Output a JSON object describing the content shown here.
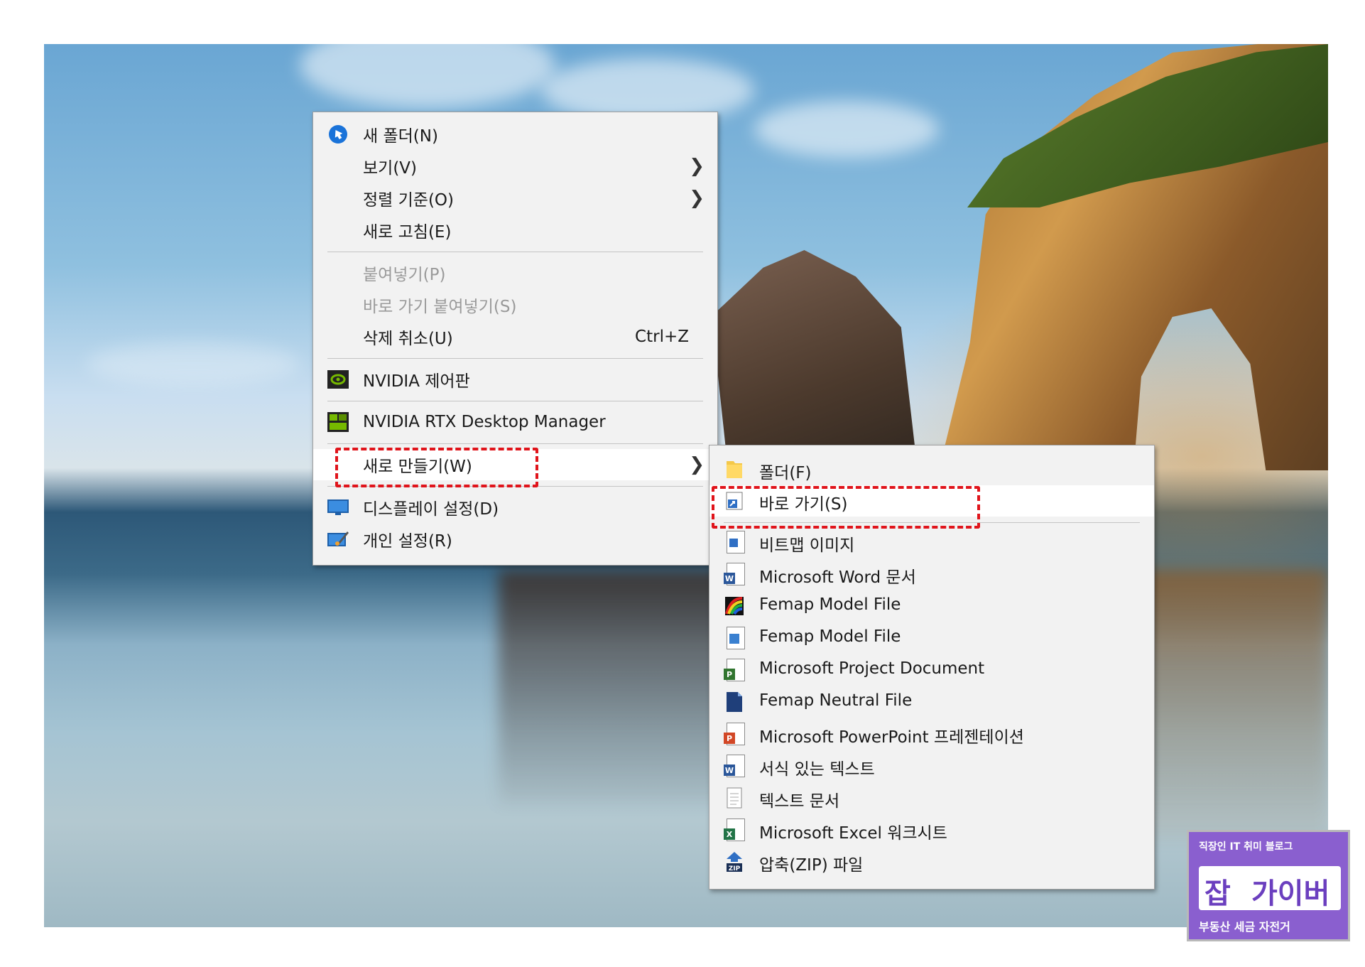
{
  "main_menu": {
    "items": [
      {
        "label": "새 폴더(N)",
        "icon": "new-folder-icon"
      },
      {
        "label": "보기(V)",
        "submenu": true
      },
      {
        "label": "정렬 기준(O)",
        "submenu": true
      },
      {
        "label": "새로 고침(E)"
      },
      {
        "label": "붙여넣기(P)",
        "disabled": true
      },
      {
        "label": "바로 가기 붙여넣기(S)",
        "disabled": true
      },
      {
        "label": "삭제 취소(U)",
        "shortcut": "Ctrl+Z"
      },
      {
        "label": "NVIDIA 제어판",
        "icon": "nvidia-icon"
      },
      {
        "label": "NVIDIA RTX Desktop Manager",
        "icon": "nvidia-rtx-icon"
      },
      {
        "label": "새로 만들기(W)",
        "submenu": true,
        "highlighted": true
      },
      {
        "label": "디스플레이 설정(D)",
        "icon": "display-icon"
      },
      {
        "label": "개인 설정(R)",
        "icon": "personalize-icon"
      }
    ]
  },
  "sub_menu": {
    "items": [
      {
        "label": "폴더(F)",
        "icon": "folder-icon"
      },
      {
        "label": "바로 가기(S)",
        "icon": "shortcut-icon",
        "highlighted": true
      },
      {
        "label": "비트맵 이미지",
        "icon": "bitmap-icon"
      },
      {
        "label": "Microsoft Word 문서",
        "icon": "word-icon"
      },
      {
        "label": "Femap Model File",
        "icon": "femap-color-icon"
      },
      {
        "label": "Femap Model File",
        "icon": "femap-file-icon"
      },
      {
        "label": "Microsoft Project Document",
        "icon": "project-icon"
      },
      {
        "label": "Femap Neutral File",
        "icon": "femap-neutral-icon"
      },
      {
        "label": "Microsoft PowerPoint 프레젠테이션",
        "icon": "powerpoint-icon"
      },
      {
        "label": "서식 있는 텍스트",
        "icon": "rich-text-icon"
      },
      {
        "label": "텍스트 문서",
        "icon": "text-document-icon"
      },
      {
        "label": "Microsoft Excel 워크시트",
        "icon": "excel-icon"
      },
      {
        "label": "압축(ZIP) 파일",
        "icon": "zip-icon"
      }
    ]
  },
  "watermark": {
    "top": "직장인 IT 취미 블로그",
    "logo_a": "잡",
    "logo_b": "가이버",
    "bottom": "부동산 세금 자전거"
  },
  "colors": {
    "menu_bg": "#f2f2f2",
    "highlight_bg": "#ffffff",
    "annotation_red": "#e0141b",
    "watermark_purple": "#8a5fcf"
  }
}
